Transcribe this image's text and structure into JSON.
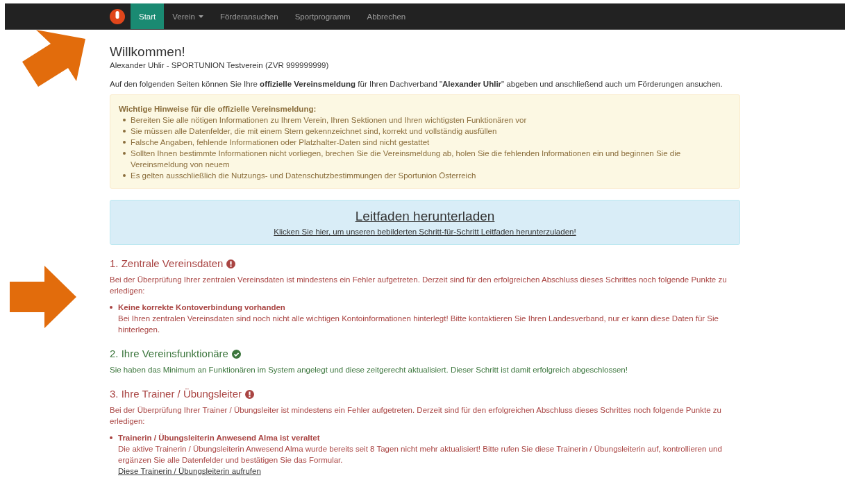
{
  "nav": {
    "items": [
      {
        "label": "Start",
        "selected": true,
        "dropdown": false
      },
      {
        "label": "Verein",
        "selected": false,
        "dropdown": true
      },
      {
        "label": "Förderansuchen",
        "selected": false,
        "dropdown": false
      },
      {
        "label": "Sportprogramm",
        "selected": false,
        "dropdown": false
      },
      {
        "label": "Abbrechen",
        "selected": false,
        "dropdown": false
      }
    ]
  },
  "title": "Willkommen!",
  "subtitle": "Alexander Uhlir - SPORTUNION Testverein (ZVR 999999999)",
  "intro": "Auf den folgenden Seiten können Sie Ihre **offizielle Vereinsmeldung** für Ihren Dachverband \"**Alexander Uhlir**\" abgeben und anschließend auch um Förderungen ansuchen.",
  "notice": {
    "title": "Wichtige Hinweise für die offizielle Vereinsmeldung:",
    "items": [
      "Bereiten Sie alle nötigen Informationen zu Ihrem Verein, Ihren Sektionen und Ihren wichtigsten Funktionären vor",
      "Sie müssen alle Datenfelder, die mit einem Stern gekennzeichnet sind, korrekt und vollständig ausfüllen",
      "Falsche Angaben, fehlende Informationen oder Platzhalter-Daten sind nicht gestattet",
      "Sollten Ihnen bestimmte Informationen nicht vorliegen, brechen Sie die Vereinsmeldung ab, holen Sie die fehlenden Informationen ein und beginnen Sie die Vereinsmeldung von neuem",
      "Es gelten ausschließlich die Nutzungs- und Datenschutzbestimmungen der Sportunion Österreich"
    ]
  },
  "guide": {
    "title": "Leitfaden herunterladen",
    "link": "Klicken Sie hier, um unseren bebilderten Schritt-für-Schritt Leitfaden herunterzuladen!"
  },
  "sections": [
    {
      "title": "1. Zentrale Vereinsdaten",
      "complete": false,
      "text": "Bei der Überprüfung Ihrer zentralen Vereinsdaten ist mindestens ein Fehler aufgetreten. Derzeit sind für den erfolgreichen Abschluss dieses Schrittes noch folgende Punkte zu erledigen:",
      "issues": [
        {
          "title": "Keine korrekte Kontoverbindung vorhanden",
          "text": "Bei Ihren zentralen Vereinsdaten sind noch nicht alle wichtigen Kontoinformationen hinterlegt! Bitte kontaktieren Sie Ihren Landesverband, nur er kann diese Daten für Sie hinterlegen."
        }
      ]
    },
    {
      "title": "2. Ihre Vereinsfunktionäre",
      "complete": true,
      "text": "Sie haben das Minimum an Funktionären im System angelegt und diese zeitgerecht aktualisiert. Dieser Schritt ist damit erfolgreich abgeschlossen!"
    },
    {
      "title": "3. Ihre Trainer / Übungsleiter",
      "complete": false,
      "text": "Bei der Überprüfung Ihrer Trainer / Übungsleiter ist mindestens ein Fehler aufgetreten. Derzeit sind für den erfolgreichen Abschluss dieses Schrittes noch folgende Punkte zu erledigen:",
      "issues": [
        {
          "title": "Trainerin / Übungsleiterin Anwesend Alma ist veraltet",
          "text": "Die aktive Trainerin / Übungsleiterin Anwesend Alma wurde bereits seit 8 Tagen nicht mehr aktualisiert! Bitte rufen Sie diese Trainerin / Übungsleiterin auf, kontrollieren und ergänzen Sie alle Datenfelder und bestätigen Sie das Formular.",
          "link": "Diese Trainerin / Übungsleiterin aufrufen"
        }
      ]
    }
  ]
}
